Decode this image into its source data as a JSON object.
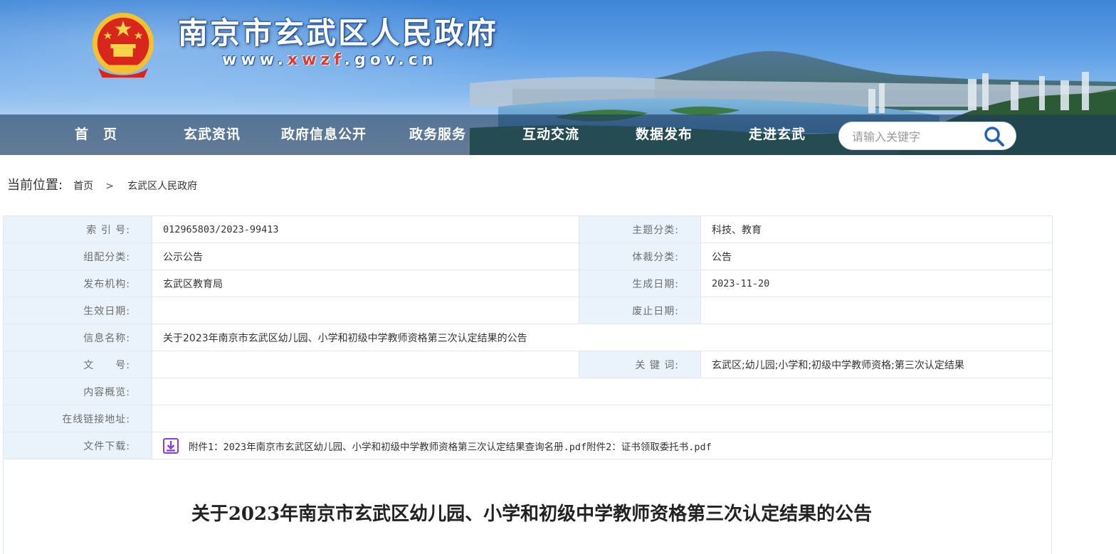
{
  "header": {
    "site_title": "南京市玄武区人民政府",
    "site_url_prefix": "www.",
    "site_url_accent": "xwzf",
    "site_url_suffix": ".gov.cn",
    "emblem_icon": "national-emblem-icon",
    "colors": {
      "banner_sky": "#4a8fdc",
      "nav_bg": "#1c3a5f",
      "url_accent": "#e03a2f"
    }
  },
  "nav": {
    "items": [
      {
        "label": "首　页"
      },
      {
        "label": "玄武资讯"
      },
      {
        "label": "政府信息公开"
      },
      {
        "label": "政务服务"
      },
      {
        "label": "互动交流"
      },
      {
        "label": "数据发布"
      },
      {
        "label": "走进玄武"
      }
    ],
    "search": {
      "placeholder": "请输入关键字",
      "icon": "search-icon"
    }
  },
  "breadcrumb": {
    "label": "当前位置:",
    "items": [
      "首页",
      "玄武区人民政府"
    ],
    "separator": ">"
  },
  "info": {
    "index_no_label": "索 引 号:",
    "index_no": "012965803/2023-99413",
    "topic_label": "主题分类:",
    "topic": "科技、教育",
    "category_label": "组配分类:",
    "category": "公示公告",
    "genre_label": "体裁分类:",
    "genre": "公告",
    "publisher_label": "发布机构:",
    "publisher": "玄武区教育局",
    "created_label": "生成日期:",
    "created": "2023-11-20",
    "effective_label": "生效日期:",
    "effective": "",
    "abolished_label": "废止日期:",
    "abolished": "",
    "name_label": "信息名称:",
    "name": "关于2023年南京市玄武区幼儿园、小学和初级中学教师资格第三次认定结果的公告",
    "doc_no_label": "文　　号:",
    "doc_no": "",
    "keywords_label": "关 键 词:",
    "keywords": "玄武区;幼儿园;小学和;初级中学教师资格;第三次认定结果",
    "summary_label": "内容概览:",
    "summary": "",
    "link_label": "在线链接地址:",
    "link": "",
    "download_label": "文件下载:",
    "download_icon": "download-icon",
    "downloads": "附件1：2023年南京市玄武区幼儿园、小学和初级中学教师资格第三次认定结果查询名册.pdf附件2：证书领取委托书.pdf"
  },
  "article": {
    "title": "关于2023年南京市玄武区幼儿园、小学和初级中学教师资格第三次认定结果的公告"
  }
}
